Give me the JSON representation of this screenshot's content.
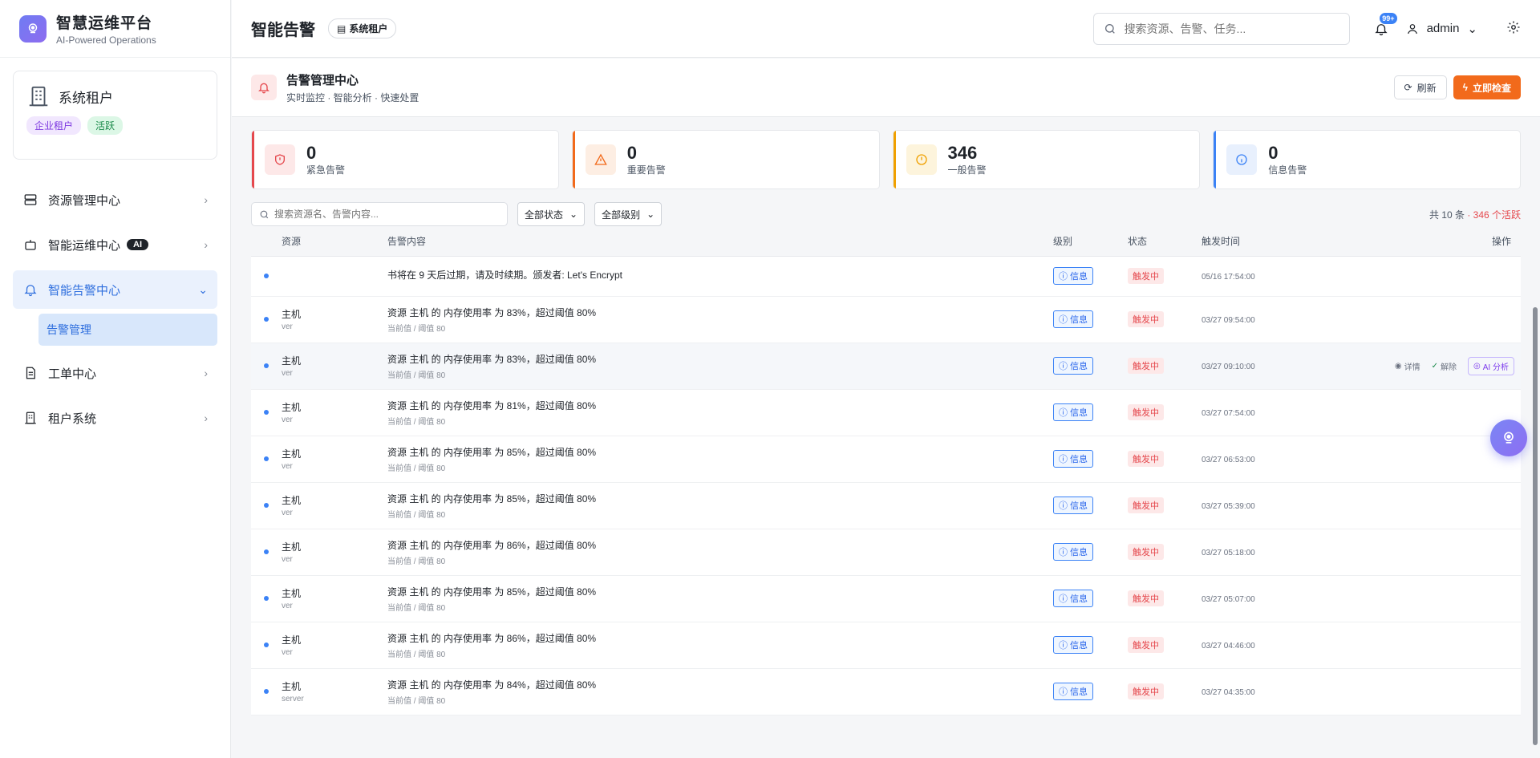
{
  "brand": {
    "title": "智慧运维平台",
    "subtitle": "AI-Powered Operations"
  },
  "tenant_card": {
    "name": "系统租户",
    "tags": [
      "企业租户",
      "活跃"
    ]
  },
  "sidebar": {
    "items": [
      {
        "label": "资源管理中心",
        "icon": "server-icon"
      },
      {
        "label": "智能运维中心",
        "icon": "robot-icon",
        "badge": "AI"
      },
      {
        "label": "智能告警中心",
        "icon": "bell-icon",
        "active": true
      },
      {
        "label": "工单中心",
        "icon": "document-icon"
      },
      {
        "label": "租户系统",
        "icon": "building-icon"
      }
    ],
    "sub_item": "告警管理"
  },
  "header": {
    "title": "智能告警",
    "tenant_pill": "系统租户",
    "search_placeholder": "搜索资源、告警、任务...",
    "notif_badge": "99+",
    "user": "admin"
  },
  "subheader": {
    "title": "告警管理中心",
    "subtitle": "实时监控 · 智能分析 · 快速处置",
    "refresh": "刷新",
    "check": "立即检查"
  },
  "stats": [
    {
      "value": "0",
      "label": "紧急告警",
      "color": "#e5484d",
      "bg": "#fde8e8",
      "icon": "shield-alert-icon"
    },
    {
      "value": "0",
      "label": "重要告警",
      "color": "#f26a1b",
      "bg": "#fdeee3",
      "icon": "warning-triangle-icon"
    },
    {
      "value": "346",
      "label": "一般告警",
      "color": "#f0a000",
      "bg": "#fdf4dc",
      "icon": "alert-circle-icon"
    },
    {
      "value": "0",
      "label": "信息告警",
      "color": "#3b82f6",
      "bg": "#e8f0fd",
      "icon": "info-icon"
    }
  ],
  "filters": {
    "search_placeholder": "搜索资源名、告警内容...",
    "status": "全部状态",
    "level": "全部级别",
    "count_prefix": "共 10 条",
    "active_count": "· 346 个活跃"
  },
  "table": {
    "columns": [
      "资源",
      "告警内容",
      "级别",
      "状态",
      "触发时间",
      "操作"
    ],
    "rows": [
      {
        "res": "",
        "type": "",
        "msg": "书将在 9 天后过期，请及时续期。颁发者: Let's Encrypt",
        "sub": "",
        "level": "信息",
        "status": "触发中",
        "time": "05/16 17:54:00"
      },
      {
        "res": "主机",
        "type": "ver",
        "msg": "资源 主机 的 内存使用率 为 83%，超过阈值 80%",
        "sub": "当前值 / 阈值 80",
        "level": "信息",
        "status": "触发中",
        "time": "03/27 09:54:00"
      },
      {
        "res": "主机",
        "type": "ver",
        "msg": "资源 主机 的 内存使用率 为 83%，超过阈值 80%",
        "sub": "当前值 / 阈值 80",
        "level": "信息",
        "status": "触发中",
        "time": "03/27 09:10:00"
      },
      {
        "res": "主机",
        "type": "ver",
        "msg": "资源 主机 的 内存使用率 为 81%，超过阈值 80%",
        "sub": "当前值 / 阈值 80",
        "level": "信息",
        "status": "触发中",
        "time": "03/27 07:54:00"
      },
      {
        "res": "主机",
        "type": "ver",
        "msg": "资源 主机 的 内存使用率 为 85%，超过阈值 80%",
        "sub": "当前值 / 阈值 80",
        "level": "信息",
        "status": "触发中",
        "time": "03/27 06:53:00"
      },
      {
        "res": "主机",
        "type": "ver",
        "msg": "资源 主机 的 内存使用率 为 85%，超过阈值 80%",
        "sub": "当前值 / 阈值 80",
        "level": "信息",
        "status": "触发中",
        "time": "03/27 05:39:00"
      },
      {
        "res": "主机",
        "type": "ver",
        "msg": "资源 主机 的 内存使用率 为 86%，超过阈值 80%",
        "sub": "当前值 / 阈值 80",
        "level": "信息",
        "status": "触发中",
        "time": "03/27 05:18:00"
      },
      {
        "res": "主机",
        "type": "ver",
        "msg": "资源 主机 的 内存使用率 为 85%，超过阈值 80%",
        "sub": "当前值 / 阈值 80",
        "level": "信息",
        "status": "触发中",
        "time": "03/27 05:07:00"
      },
      {
        "res": "主机",
        "type": "ver",
        "msg": "资源 主机 的 内存使用率 为 86%，超过阈值 80%",
        "sub": "当前值 / 阈值 80",
        "level": "信息",
        "status": "触发中",
        "time": "03/27 04:46:00"
      },
      {
        "res": "主机",
        "type": "server",
        "msg": "资源 主机 的 内存使用率 为 84%，超过阈值 80%",
        "sub": "当前值 / 阈值 80",
        "level": "信息",
        "status": "触发中",
        "time": "03/27 04:35:00"
      }
    ],
    "row_actions": {
      "detail": "详情",
      "resolve": "解除",
      "ai": "AI 分析"
    }
  }
}
